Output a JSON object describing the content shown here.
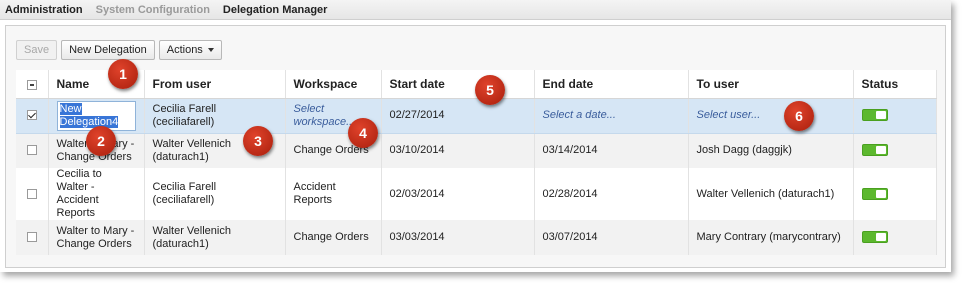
{
  "breadcrumb": [
    "Administration",
    "System Configuration",
    "Delegation Manager"
  ],
  "toolbar": {
    "save": "Save",
    "new": "New Delegation",
    "actions": "Actions"
  },
  "columns": [
    "Name",
    "From user",
    "Workspace",
    "Start date",
    "End date",
    "To user",
    "Status"
  ],
  "rows": [
    {
      "name": "New Delegation4",
      "from": "Cecilia Farell (ceciliafarell)",
      "workspace": "Select workspace...",
      "start": "02/27/2014",
      "end": "Select a date...",
      "to": "Select user...",
      "checked": true,
      "status": "on"
    },
    {
      "name": "Walter to Mary - Change Orders",
      "from": "Walter Vellenich (daturach1)",
      "workspace": "Change Orders",
      "start": "03/10/2014",
      "end": "03/14/2014",
      "to": "Josh Dagg (daggjk)",
      "checked": false,
      "status": "on"
    },
    {
      "name": "Cecilia to Walter - Accident Reports",
      "from": "Cecilia Farell (ceciliafarell)",
      "workspace": "Accident Reports",
      "start": "02/03/2014",
      "end": "02/28/2014",
      "to": "Walter Vellenich (daturach1)",
      "checked": false,
      "status": "on"
    },
    {
      "name": "Walter to Mary - Change Orders",
      "from": "Walter Vellenich (daturach1)",
      "workspace": "Change Orders",
      "start": "03/03/2014",
      "end": "03/07/2014",
      "to": "Mary Contrary (marycontrary)",
      "checked": false,
      "status": "on"
    }
  ],
  "markers": [
    "1",
    "2",
    "3",
    "4",
    "5",
    "6"
  ],
  "colors": {
    "toggle_on": "#5cb82e",
    "selected_row": "#d6e6f5",
    "marker": "#c8301a"
  }
}
